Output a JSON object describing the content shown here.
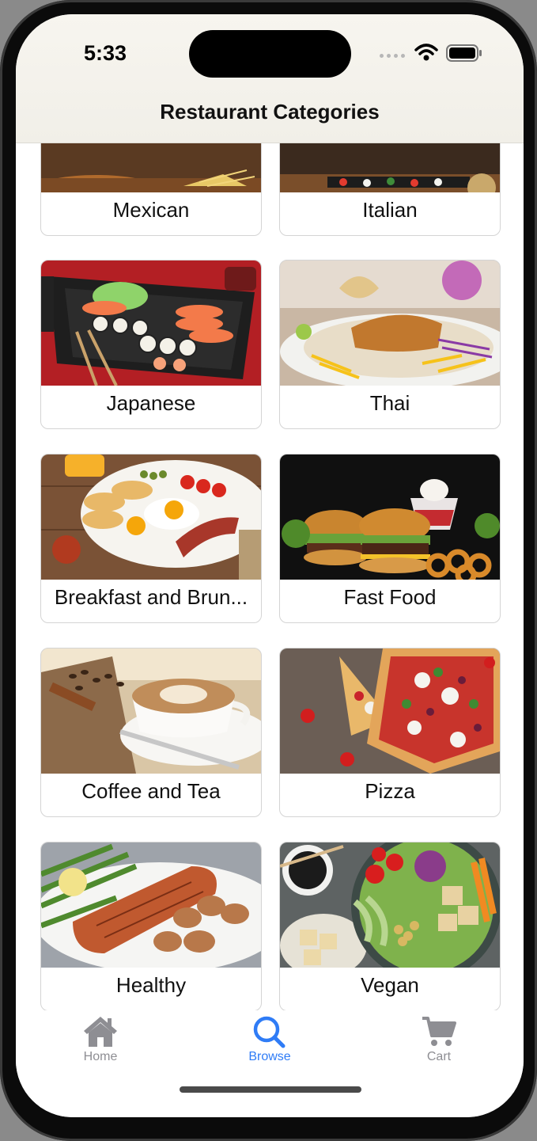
{
  "status_bar": {
    "time": "5:33"
  },
  "nav": {
    "title": "Restaurant Categories"
  },
  "categories": [
    {
      "label": "Mexican"
    },
    {
      "label": "Italian"
    },
    {
      "label": "Japanese"
    },
    {
      "label": "Thai"
    },
    {
      "label": "Breakfast and Brun..."
    },
    {
      "label": "Fast Food"
    },
    {
      "label": "Coffee and Tea"
    },
    {
      "label": "Pizza"
    },
    {
      "label": "Healthy"
    },
    {
      "label": "Vegan"
    }
  ],
  "tabs": [
    {
      "label": "Home",
      "icon": "house-icon",
      "active": false
    },
    {
      "label": "Browse",
      "icon": "magnifier-icon",
      "active": true
    },
    {
      "label": "Cart",
      "icon": "cart-icon",
      "active": false
    }
  ],
  "colors": {
    "accent": "#2f7cf6",
    "inactive_tab": "#8e8e93"
  }
}
